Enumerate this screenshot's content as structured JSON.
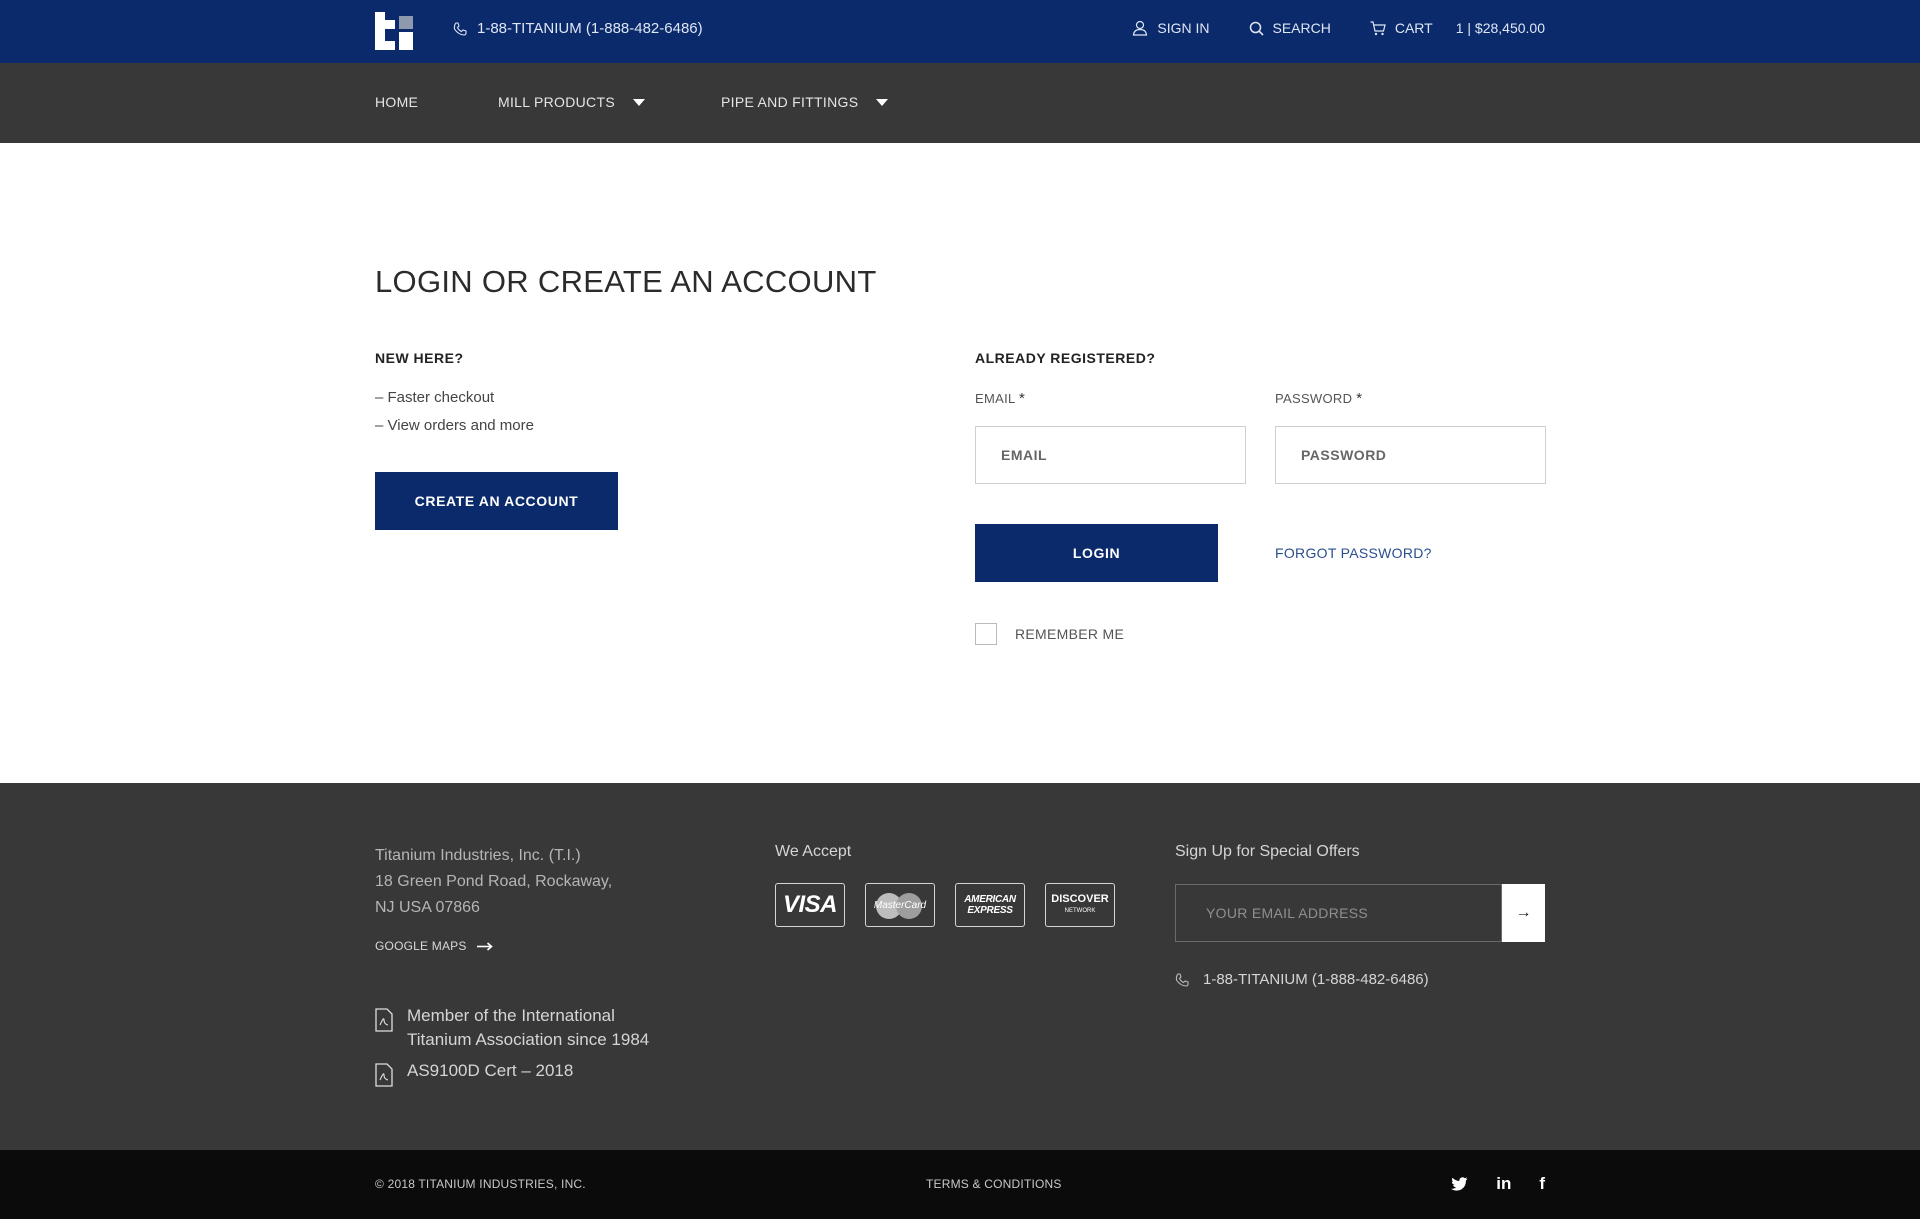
{
  "header": {
    "phone": "1-88-TITANIUM (1-888-482-6486)",
    "sign_in": "SIGN IN",
    "search": "SEARCH",
    "cart": "CART",
    "cart_summary": "1 | $28,450.00"
  },
  "nav": {
    "items": [
      {
        "label": "HOME"
      },
      {
        "label": "MILL PRODUCTS"
      },
      {
        "label": "PIPE AND FITTINGS"
      }
    ]
  },
  "main": {
    "title": "LOGIN OR CREATE AN ACCOUNT",
    "new_here": {
      "heading": "NEW HERE?",
      "benefits": [
        "– Faster checkout",
        "– View orders and more"
      ],
      "button": "CREATE AN ACCOUNT"
    },
    "registered": {
      "heading": "ALREADY REGISTERED?",
      "email_label": "EMAIL",
      "email_placeholder": "EMAIL",
      "password_label": "PASSWORD",
      "password_placeholder": "PASSWORD",
      "required_mark": "*",
      "login_button": "LOGIN",
      "forgot": "FORGOT PASSWORD?",
      "remember": "REMEMBER ME"
    }
  },
  "footer": {
    "address_lines": [
      "Titanium Industries, Inc. (T.I.)",
      "18 Green Pond Road, Rockaway,",
      "NJ USA 07866"
    ],
    "google_maps": "GOOGLE MAPS",
    "docs": [
      {
        "lines": [
          "Member of the International",
          "Titanium Association since 1984"
        ]
      },
      {
        "lines": [
          "AS9100D Cert – 2018"
        ]
      }
    ],
    "we_accept": "We Accept",
    "cards": {
      "visa": "VISA",
      "mastercard": "MasterCard",
      "amex_1": "AMERICAN",
      "amex_2": "EXPRESS",
      "discover": "DISCOVER",
      "discover_sub": "NETWORK"
    },
    "signup_title": "Sign Up for Special Offers",
    "signup_placeholder": "YOUR EMAIL ADDRESS",
    "signup_button": "→",
    "phone": "1-88-TITANIUM (1-888-482-6486)"
  },
  "bottom": {
    "copyright": "© 2018 TITANIUM INDUSTRIES, INC.",
    "terms": "TERMS & CONDITIONS",
    "social_icons": [
      "twitter-icon",
      "linkedin-icon",
      "facebook-icon"
    ],
    "linkedin_glyph": "in",
    "facebook_glyph": "f"
  },
  "colors": {
    "brand_navy": "#0a2a6b",
    "nav_gray": "#383838",
    "footer_black": "#0b0b0b"
  }
}
